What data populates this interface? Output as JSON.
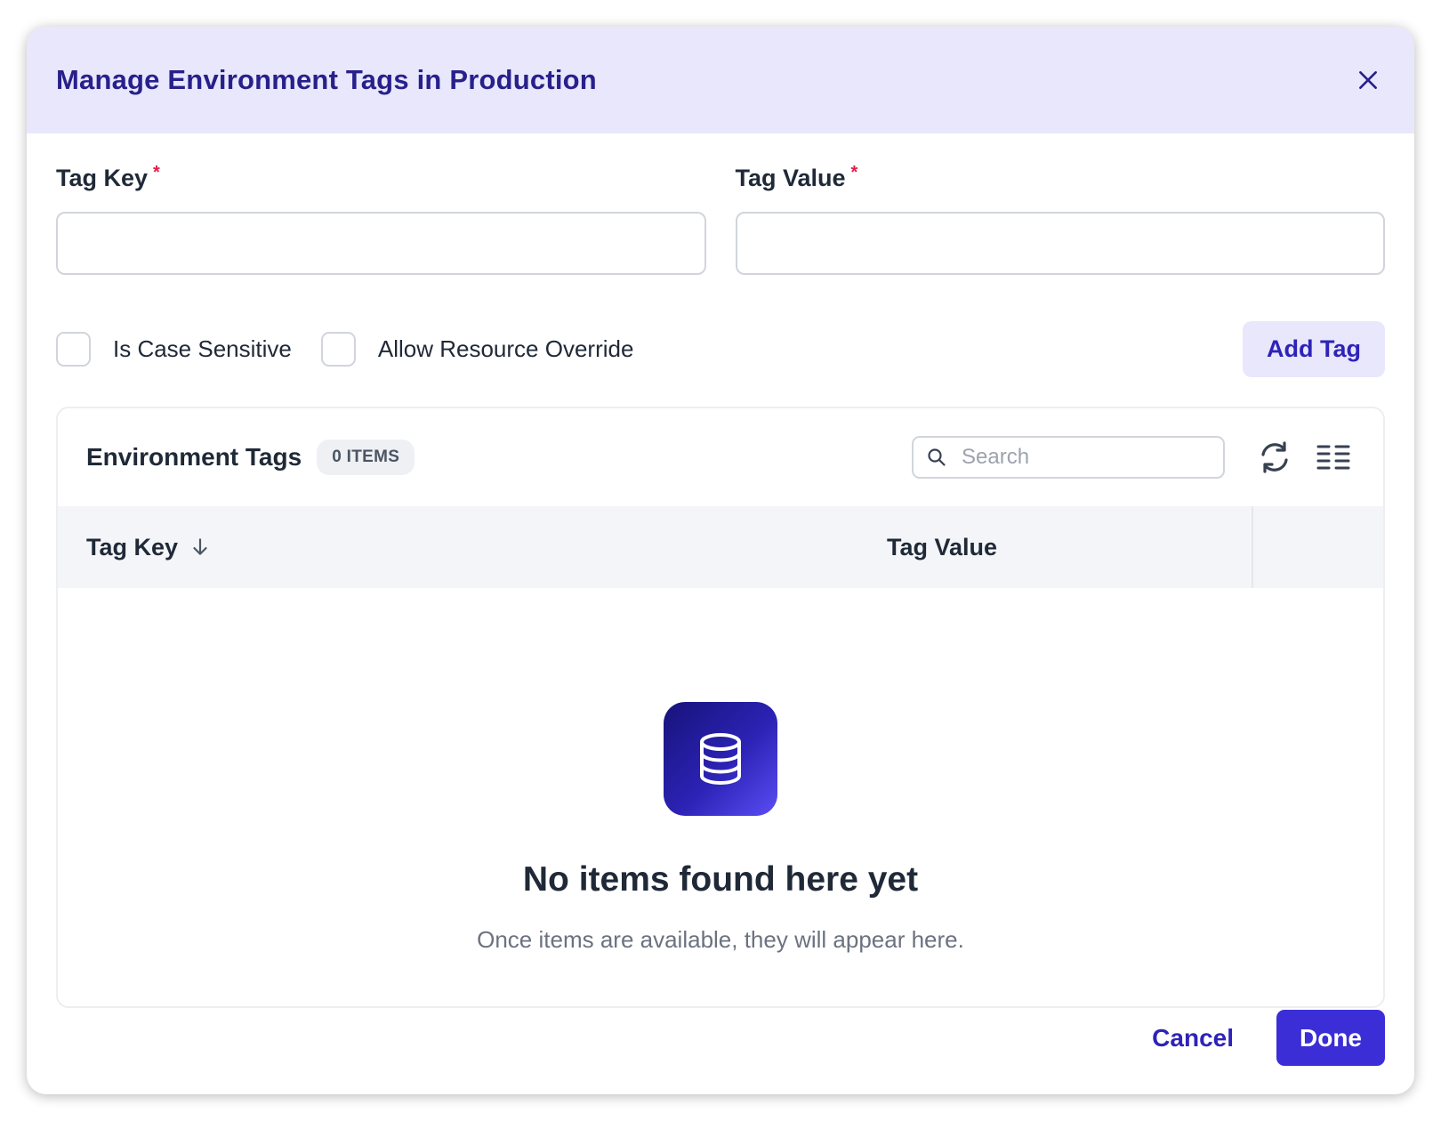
{
  "modal": {
    "title": "Manage Environment Tags in Production",
    "close_icon": "close-icon"
  },
  "form": {
    "tag_key": {
      "label": "Tag Key",
      "required_mark": "*",
      "value": "",
      "placeholder": ""
    },
    "tag_value": {
      "label": "Tag Value",
      "required_mark": "*",
      "value": "",
      "placeholder": ""
    }
  },
  "options": {
    "case_sensitive": {
      "label": "Is Case Sensitive",
      "checked": false
    },
    "allow_override": {
      "label": "Allow Resource Override",
      "checked": false
    },
    "add_button": "Add Tag"
  },
  "table": {
    "title": "Environment Tags",
    "count_badge": "0 ITEMS",
    "search": {
      "placeholder": "Search",
      "value": "",
      "icon": "search-icon"
    },
    "tools": [
      "refresh-icon",
      "column-settings-icon"
    ],
    "columns": [
      {
        "label": "Tag Key",
        "sort": "descending",
        "sort_icon": "arrow-down-icon"
      },
      {
        "label": "Tag Value"
      }
    ],
    "rows": [],
    "empty": {
      "icon": "database-icon",
      "title": "No items found here yet",
      "subtitle": "Once items are available, they will appear here."
    }
  },
  "footer": {
    "cancel_label": "Cancel",
    "done_label": "Done"
  },
  "colors": {
    "accent": "#3b2ed6",
    "header_bg": "#e8e7fc",
    "title_text": "#28208a",
    "required": "#e11d48"
  }
}
